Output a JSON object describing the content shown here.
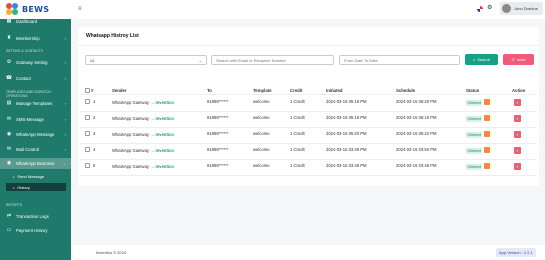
{
  "brand": {
    "name": "BEWS"
  },
  "header": {
    "user_name": "John Doedoe"
  },
  "sidebar": {
    "items": [
      {
        "label": "Dashboard",
        "icon": "dashboard-icon"
      },
      {
        "label": "Membership",
        "icon": "membership-icon"
      }
    ],
    "section_settings": "SETTING & CONTACTS",
    "settings_items": [
      {
        "label": "Gateway Setting",
        "icon": "gateway-icon"
      },
      {
        "label": "Contact",
        "icon": "contact-icon"
      }
    ],
    "section_templates": "TEMPLATES AND DISPATCH OPERATIONS",
    "template_items": [
      {
        "label": "Manage Templates",
        "icon": "templates-icon"
      },
      {
        "label": "SMS Message",
        "icon": "sms-icon"
      },
      {
        "label": "WhatsApp Message",
        "icon": "whatsapp-icon"
      },
      {
        "label": "Mail Control",
        "icon": "mail-icon"
      },
      {
        "label": "WhatsApp Business",
        "icon": "whatsapp-business-icon"
      }
    ],
    "sub_items": [
      {
        "label": "Send Message"
      },
      {
        "label": "History"
      }
    ],
    "section_reports": "REPORTS",
    "report_items": [
      {
        "label": "Transaction Logs",
        "icon": "transaction-icon"
      },
      {
        "label": "Payment History",
        "icon": "payment-icon"
      }
    ]
  },
  "page": {
    "title": "Whatsapp Histroy List"
  },
  "filters": {
    "status_value": "All",
    "search_placeholder": "Search with Email or Recipient Number",
    "date_placeholder": "From Date To Date",
    "search_label": "Search",
    "reset_label": "reset"
  },
  "table": {
    "headers": [
      "#",
      "Sender",
      "To",
      "Template",
      "Credit",
      "Initiated",
      "Schedule",
      "Status",
      "Action"
    ],
    "rows": [
      {
        "num": "1",
        "sender": "WhatsApp Gateway",
        "via": "Inventico",
        "to": "91888******",
        "template": "welcome",
        "credit": "1 Credit",
        "initiated": "2024-03-15 06:18 PM",
        "schedule": "2024-03-15 06:20 PM",
        "status": "Delivered"
      },
      {
        "num": "2",
        "sender": "WhatsApp Gateway",
        "via": "Inventico",
        "to": "91888******",
        "template": "welcome",
        "credit": "1 Credit",
        "initiated": "2024-03-15 06:18 PM",
        "schedule": "2024-03-15 06:16 PM",
        "status": "Delivered"
      },
      {
        "num": "3",
        "sender": "WhatsApp Gateway",
        "via": "Inventico",
        "to": "91888******",
        "template": "welcome",
        "credit": "1 Credit",
        "initiated": "2024-03-15 05:20 PM",
        "schedule": "2024-03-15 05:22 PM",
        "status": "Delivered"
      },
      {
        "num": "4",
        "sender": "WhatsApp Gateway",
        "via": "Inventico",
        "to": "91888******",
        "template": "welcome",
        "credit": "1 Credit",
        "initiated": "2024-03-15 03:49 PM",
        "schedule": "2024-03-15 03:50 PM",
        "status": "Delivered"
      },
      {
        "num": "5",
        "sender": "WhatsApp Gateway",
        "via": "Inventico",
        "to": "91888******",
        "template": "welcome",
        "credit": "1 Credit",
        "initiated": "2024-03-15 03:48 PM",
        "schedule": "2024-03-15 03:48 PM",
        "status": "Delivered"
      }
    ]
  },
  "footer": {
    "copyright": "Inventico © 2024",
    "version": "App Version : 2.2.1"
  },
  "colors": {
    "sidebar": "#1f7a6b",
    "accent": "#16a085",
    "danger": "#f35a7a"
  }
}
